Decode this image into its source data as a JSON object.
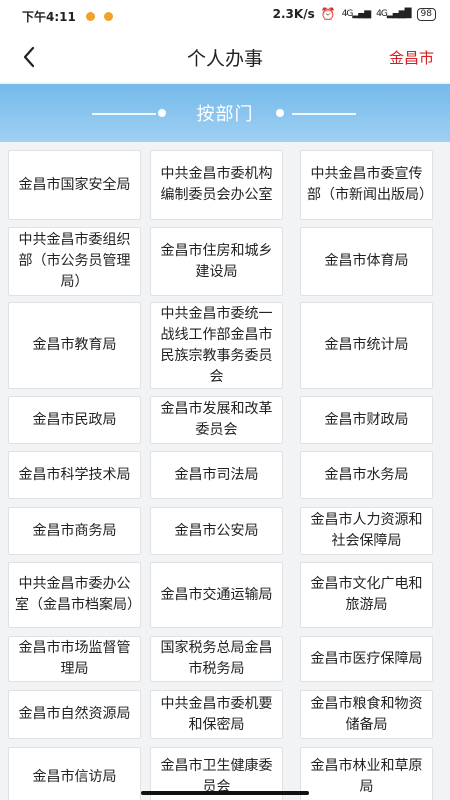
{
  "status": {
    "time": "下午4:11",
    "speed": "2.3K/s",
    "net1": "4G",
    "net2": "4G",
    "battery": "98"
  },
  "header": {
    "title": "个人办事",
    "city": "金昌市"
  },
  "banner": {
    "label": "按部门"
  },
  "departments": [
    "金昌市国家安全局",
    "中共金昌市委机构编制委员会办公室",
    "中共金昌市委宣传部（市新闻出版局）",
    "中共金昌市委组织部（市公务员管理局）",
    "金昌市住房和城乡建设局",
    "金昌市体育局",
    "金昌市教育局",
    "中共金昌市委统一战线工作部金昌市民族宗教事务委员会",
    "金昌市统计局",
    "金昌市民政局",
    "金昌市发展和改革委员会",
    "金昌市财政局",
    "金昌市科学技术局",
    "金昌市司法局",
    "金昌市水务局",
    "金昌市商务局",
    "金昌市公安局",
    "金昌市人力资源和社会保障局",
    "中共金昌市委办公室（金昌市档案局）",
    "金昌市交通运输局",
    "金昌市文化广电和旅游局",
    "金昌市市场监督管理局",
    "国家税务总局金昌市税务局",
    "金昌市医疗保障局",
    "金昌市自然资源局",
    "中共金昌市委机要和保密局",
    "金昌市粮食和物资储备局",
    "金昌市信访局",
    "金昌市卫生健康委员会",
    "金昌市林业和草原局"
  ]
}
